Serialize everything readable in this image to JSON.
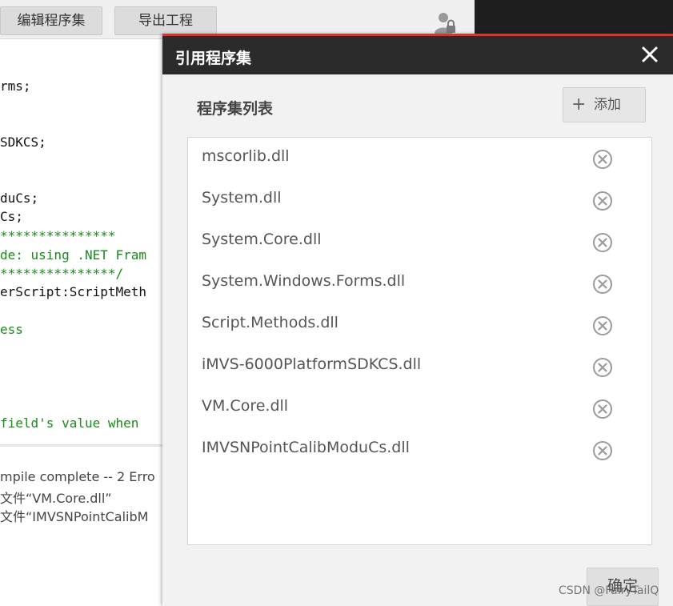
{
  "toolbar": {
    "edit_assemblies_label": "编辑程序集",
    "export_project_label": "导出工程"
  },
  "code_lines": [
    {
      "text": "rms;",
      "color": "#111111"
    },
    {
      "text": "SDKCS;",
      "color": "#111111"
    },
    {
      "text": "duCs;",
      "color": "#111111"
    },
    {
      "text": "Cs;",
      "color": "#111111"
    },
    {
      "text": "***************",
      "color": "#1a8a1a"
    },
    {
      "text": "de: using .NET Fram",
      "color": "#1a8a1a"
    },
    {
      "text": "***************/",
      "color": "#1a8a1a"
    },
    {
      "text": "erScript:ScriptMeth",
      "color": "#111111"
    },
    {
      "text": "ess",
      "color": "#1a8a1a"
    },
    {
      "text": "field's value when",
      "color": "#1a8a1a"
    }
  ],
  "output_lines": [
    "mpile complete -- 2 Erro",
    "文件“VM.Core.dll”",
    "文件“IMVSNPointCalibM"
  ],
  "dialog": {
    "title": "引用程序集",
    "section_title": "程序集列表",
    "add_label": "添加",
    "ok_label": "确定",
    "assemblies": [
      "mscorlib.dll",
      "System.dll",
      "System.Core.dll",
      "System.Windows.Forms.dll",
      "Script.Methods.dll",
      "iMVS-6000PlatformSDKCS.dll",
      "VM.Core.dll",
      "IMVSNPointCalibModuCs.dll"
    ]
  },
  "watermark": "CSDN @FairyTailQ",
  "icons": {
    "close": "close-icon",
    "remove": "remove-circle-x-icon",
    "add": "plus-icon",
    "user": "user-lock-icon"
  },
  "colors": {
    "dialog_accent": "#e0322d",
    "dialog_header": "#2b2b2b",
    "code_comment": "#1a8a1a"
  }
}
